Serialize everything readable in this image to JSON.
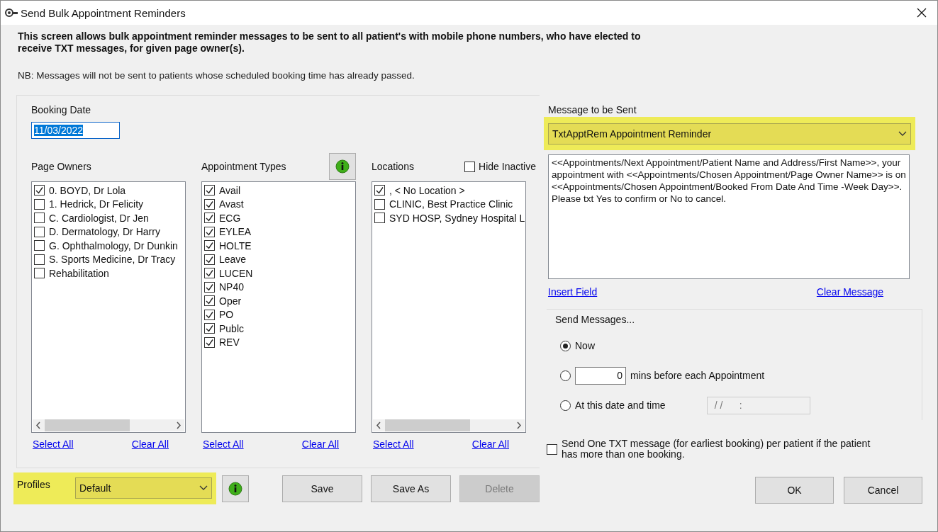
{
  "window": {
    "title": "Send Bulk Appointment Reminders"
  },
  "intro": "This screen allows bulk appointment reminder messages to be sent to all patient's with mobile phone numbers, who have elected to receive TXT messages, for given page owner(s).",
  "note": "NB: Messages will not be sent  to patients whose scheduled booking time has already passed.",
  "booking_date": {
    "label": "Booking Date",
    "value": "11/03/2022",
    "selected": true
  },
  "lists": [
    {
      "title": "Page Owners",
      "horizontal_scrollbar": true,
      "info_button": false,
      "items": [
        {
          "label": "0. BOYD, Dr Lola",
          "checked": true
        },
        {
          "label": "1. Hedrick, Dr Felicity",
          "checked": false
        },
        {
          "label": "C. Cardiologist, Dr Jen",
          "checked": false
        },
        {
          "label": "D. Dermatology, Dr Harry",
          "checked": false
        },
        {
          "label": "G. Ophthalmology, Dr Dunkin",
          "checked": false
        },
        {
          "label": "S. Sports Medicine, Dr Tracy",
          "checked": false
        },
        {
          "label": "Rehabilitation",
          "checked": false
        }
      ],
      "links": [
        "Select All",
        "Clear All"
      ]
    },
    {
      "title": "Appointment Types",
      "horizontal_scrollbar": false,
      "info_button": true,
      "items": [
        {
          "label": "Avail",
          "checked": true
        },
        {
          "label": "Avast",
          "checked": true
        },
        {
          "label": "ECG",
          "checked": true
        },
        {
          "label": "EYLEA",
          "checked": true
        },
        {
          "label": "HOLTE",
          "checked": true
        },
        {
          "label": "Leave",
          "checked": true
        },
        {
          "label": "LUCEN",
          "checked": true
        },
        {
          "label": "NP40",
          "checked": true
        },
        {
          "label": "Oper",
          "checked": true
        },
        {
          "label": "PO",
          "checked": true
        },
        {
          "label": "Publc",
          "checked": true
        },
        {
          "label": "REV",
          "checked": true
        }
      ],
      "links": [
        "Select All",
        "Clear All"
      ]
    },
    {
      "title": "Locations",
      "horizontal_scrollbar": true,
      "info_button": false,
      "option": {
        "label": "Hide Inactive",
        "checked": false
      },
      "items": [
        {
          "label": ", < No Location >",
          "checked": true
        },
        {
          "label": "CLINIC, Best Practice Clinic",
          "checked": false
        },
        {
          "label": "SYD HOSP, Sydney Hospital L",
          "checked": false
        }
      ],
      "links": [
        "Select All",
        "Clear All"
      ]
    }
  ],
  "profiles": {
    "label": "Profiles",
    "value": "Default",
    "highlighted": true
  },
  "profile_buttons": [
    {
      "label": "Save",
      "disabled": false
    },
    {
      "label": "Save As",
      "disabled": false
    },
    {
      "label": "Delete",
      "disabled": true
    }
  ],
  "message": {
    "label": "Message to be Sent",
    "template": "TxtApptRem Appointment Reminder",
    "highlighted": true,
    "text": "<<Appointments/Next Appointment/Patient Name and Address/First Name>>, your appointment with <<Appointments/Chosen Appointment/Page Owner Name>> is on <<Appointments/Chosen Appointment/Booked From Date And Time -Week Day>>. Please txt Yes to confirm or No to cancel.",
    "links": [
      "Insert Field",
      "Clear Message"
    ]
  },
  "send_messages": {
    "label": "Send Messages...",
    "options": [
      {
        "kind": "plain",
        "label": "Now",
        "selected": true
      },
      {
        "kind": "minutes",
        "value": "0",
        "label": "mins before each Appointment",
        "selected": false
      },
      {
        "kind": "datetime",
        "label": "At this date and time",
        "value": "/ /      :",
        "selected": false
      }
    ]
  },
  "one_per_patient": {
    "label": "Send One TXT message (for earliest booking) per patient if the patient has more than one booking.",
    "checked": false
  },
  "dialog_buttons": [
    {
      "label": "OK",
      "disabled": false
    },
    {
      "label": "Cancel",
      "disabled": false
    }
  ]
}
